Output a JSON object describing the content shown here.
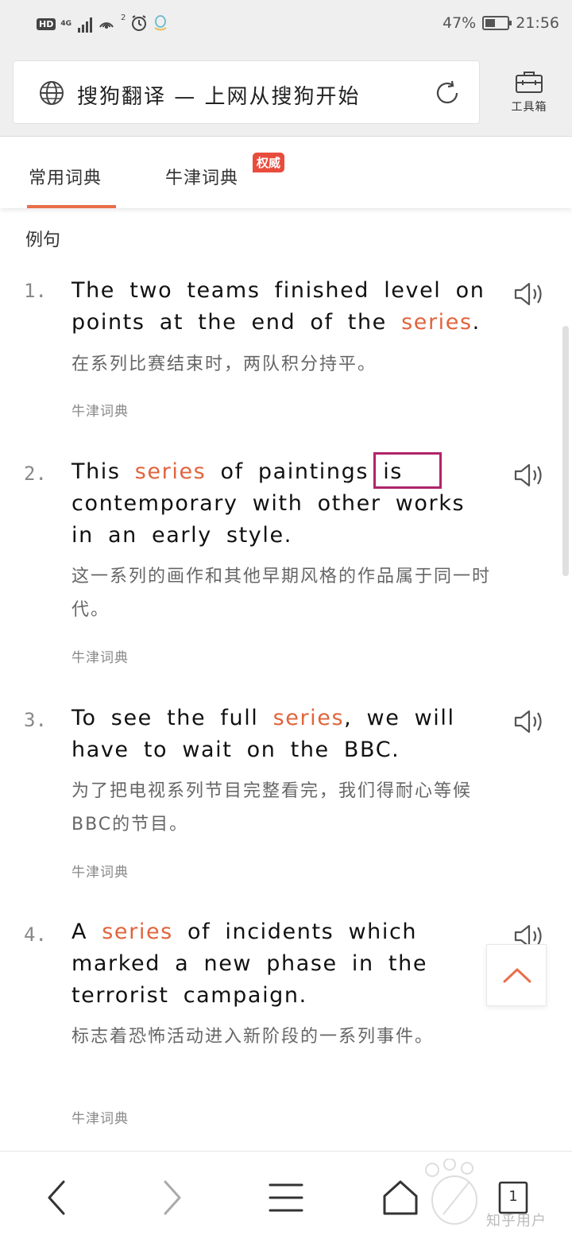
{
  "status_bar": {
    "hd": "HD",
    "network": "4G",
    "hotspot_count": "2",
    "battery_percent": "47%",
    "battery_level": 0.47,
    "time": "21:56"
  },
  "header": {
    "search_title": "搜狗翻译 — 上网从搜狗开始",
    "toolbox_label": "工具箱"
  },
  "tabs": [
    {
      "label": "常用词典",
      "active": true
    },
    {
      "label": "牛津词典",
      "badge": "权威"
    }
  ],
  "section_title": "例句",
  "examples": [
    {
      "number": "1.",
      "en_parts": [
        "The two teams finished level on points at the end of the ",
        "series",
        "."
      ],
      "zh": "在系列比赛结束时，两队积分持平。",
      "source": "牛津词典"
    },
    {
      "number": "2.",
      "en_parts": [
        "This ",
        "series",
        " of paintings is contemporary with other works in an early style."
      ],
      "zh": "这一系列的画作和其他早期风格的作品属于同一时代。",
      "source": "牛津词典"
    },
    {
      "number": "3.",
      "en_parts": [
        "To see the full ",
        "series",
        ", we will have to wait on the BBC."
      ],
      "zh": "为了把电视系列节目完整看完，我们得耐心等候BBC的节目。",
      "source": "牛津词典"
    },
    {
      "number": "4.",
      "en_parts": [
        "A ",
        "series",
        " of incidents which marked a new phase in the terrorist campaign."
      ],
      "zh": "标志着恐怖活动进入新阶段的一系列事件。",
      "source": "牛津词典"
    }
  ],
  "bottom_nav": {
    "tab_count": "1"
  },
  "watermark": "知乎用户",
  "colors": {
    "accent": "#e86f4a",
    "highlight": "#e0643c",
    "badge": "#e84c3d",
    "annotation_box": "#b0246a"
  }
}
